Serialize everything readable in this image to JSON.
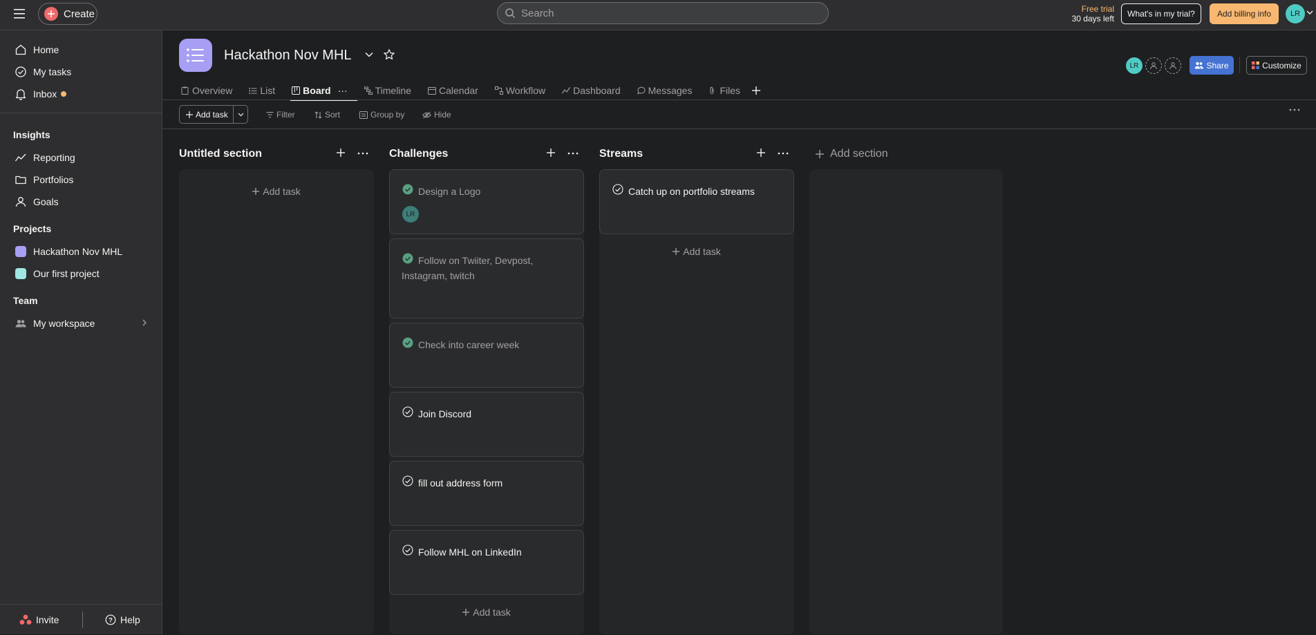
{
  "topbar": {
    "create_label": "Create",
    "search_placeholder": "Search",
    "trial_line1": "Free trial",
    "trial_line2": "30 days left",
    "whats_label": "What's in my trial?",
    "billing_label": "Add billing info",
    "avatar_initials": "LR"
  },
  "sidebar": {
    "nav": [
      {
        "label": "Home",
        "icon": "home-icon"
      },
      {
        "label": "My tasks",
        "icon": "check-circle-icon"
      },
      {
        "label": "Inbox",
        "icon": "bell-icon"
      }
    ],
    "insights_heading": "Insights",
    "insights": [
      {
        "label": "Reporting",
        "icon": "chart-line-icon"
      },
      {
        "label": "Portfolios",
        "icon": "folder-icon"
      },
      {
        "label": "Goals",
        "icon": "person-icon"
      }
    ],
    "projects_heading": "Projects",
    "projects": [
      {
        "label": "Hackathon Nov MHL",
        "color": "#a69ff3"
      },
      {
        "label": "Our first project",
        "color": "#9ee7e3"
      }
    ],
    "team_heading": "Team",
    "team": [
      {
        "label": "My workspace",
        "icon": "people-icon"
      }
    ],
    "invite_label": "Invite",
    "help_label": "Help"
  },
  "project": {
    "title": "Hackathon Nov MHL",
    "member_initials": "LR",
    "share_label": "Share",
    "customize_label": "Customize"
  },
  "tabs": [
    {
      "label": "Overview",
      "icon": "clipboard-icon"
    },
    {
      "label": "List",
      "icon": "list-icon"
    },
    {
      "label": "Board",
      "icon": "board-icon"
    },
    {
      "label": "Timeline",
      "icon": "timeline-icon"
    },
    {
      "label": "Calendar",
      "icon": "calendar-icon"
    },
    {
      "label": "Workflow",
      "icon": "workflow-icon"
    },
    {
      "label": "Dashboard",
      "icon": "dashboard-icon"
    },
    {
      "label": "Messages",
      "icon": "message-icon"
    },
    {
      "label": "Files",
      "icon": "paperclip-icon"
    }
  ],
  "tab_more": "···",
  "toolbar": {
    "add_task_label": "Add task",
    "filter_label": "Filter",
    "sort_label": "Sort",
    "groupby_label": "Group by",
    "hide_label": "Hide"
  },
  "board": {
    "add_task_label": "Add task",
    "add_section_label": "Add section",
    "columns": [
      {
        "title": "Untitled section",
        "cards": []
      },
      {
        "title": "Challenges",
        "cards": [
          {
            "title": "Design a Logo",
            "completed": true,
            "assignee": "LR"
          },
          {
            "title": "Follow on Twiiter, Devpost, Instagram, twitch",
            "completed": true
          },
          {
            "title": "Check into career week",
            "completed": true
          },
          {
            "title": "Join Discord",
            "completed": false
          },
          {
            "title": "fill out address form",
            "completed": false
          },
          {
            "title": "Follow MHL on LinkedIn",
            "completed": false
          }
        ]
      },
      {
        "title": "Streams",
        "cards": [
          {
            "title": "Catch up on portfolio streams",
            "completed": false
          }
        ]
      }
    ]
  },
  "colors": {
    "accent_blue": "#4573d2",
    "trial_orange": "#f8b871",
    "create_red": "#f06a6a",
    "avatar_teal": "#4ecbc4",
    "done_green": "#58a182"
  }
}
